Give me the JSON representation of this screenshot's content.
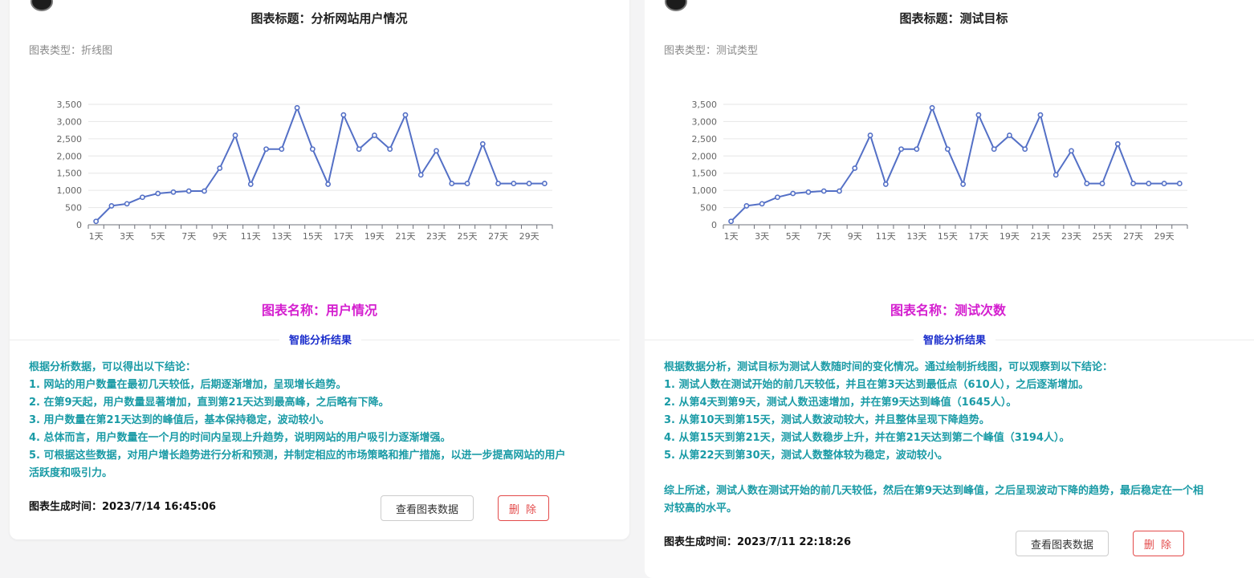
{
  "cards": [
    {
      "chart_title": "图表标题：分析网站用户情况",
      "chart_type_prefix": "图表类型：",
      "chart_type": "折线图",
      "chart_name": "图表名称：用户情况",
      "analysis_heading": "智能分析结果",
      "analysis_lines": [
        "根据分析数据，可以得出以下结论：",
        "1. 网站的用户数量在最初几天较低，后期逐渐增加，呈现增长趋势。",
        "2. 在第9天起，用户数量显著增加，直到第21天达到最高峰，之后略有下降。",
        "3. 用户数量在第21天达到的峰值后，基本保持稳定，波动较小。",
        "4. 总体而言，用户数量在一个月的时间内呈现上升趋势，说明网站的用户吸引力逐渐增强。",
        "5. 可根据这些数据，对用户增长趋势进行分析和预测，并制定相应的市场策略和推广措施，以进一步提高网站的用户",
        "活跃度和吸引力。"
      ],
      "generated_time": "图表生成时间：2023/7/14 16:45:06",
      "view_button": "查看图表数据",
      "delete_button": "删 除"
    },
    {
      "chart_title": "图表标题：测试目标",
      "chart_type_prefix": "图表类型：",
      "chart_type": "测试类型",
      "chart_name": "图表名称：测试次数",
      "analysis_heading": "智能分析结果",
      "analysis_lines": [
        "根据数据分析，测试目标为测试人数随时间的变化情况。通过绘制折线图，可以观察到以下结论：",
        "1. 测试人数在测试开始的前几天较低，并且在第3天达到最低点（610人），之后逐渐增加。",
        "2. 从第4天到第9天，测试人数迅速增加，并在第9天达到峰值（1645人）。",
        "3. 从第10天到第15天，测试人数波动较大，并且整体呈现下降趋势。",
        "4. 从第15天到第21天，测试人数稳步上升，并在第21天达到第二个峰值（3194人）。",
        "5. 从第22天到第30天，测试人数整体较为稳定，波动较小。",
        "",
        "综上所述，测试人数在测试开始的前几天较低，然后在第9天达到峰值，之后呈现波动下降的趋势，最后稳定在一个相",
        "对较高的水平。"
      ],
      "generated_time": "图表生成时间：2023/7/11 22:18:26",
      "view_button": "查看图表数据",
      "delete_button": "删 除"
    }
  ],
  "chart_data": [
    {
      "type": "line",
      "categories": [
        "1天",
        "2天",
        "3天",
        "4天",
        "5天",
        "6天",
        "7天",
        "8天",
        "9天",
        "10天",
        "11天",
        "12天",
        "13天",
        "14天",
        "15天",
        "16天",
        "17天",
        "18天",
        "19天",
        "20天",
        "21天",
        "22天",
        "23天",
        "24天",
        "25天",
        "26天",
        "27天",
        "28天",
        "29天",
        "30天"
      ],
      "tick_labels": [
        "1天",
        "3天",
        "5天",
        "7天",
        "9天",
        "11天",
        "13天",
        "15天",
        "17天",
        "19天",
        "21天",
        "23天",
        "25天",
        "27天",
        "29天"
      ],
      "values": [
        100,
        550,
        610,
        800,
        910,
        950,
        980,
        980,
        1645,
        2600,
        1180,
        2200,
        2200,
        3400,
        2200,
        1180,
        3194,
        2200,
        2600,
        2200,
        3194,
        1450,
        2150,
        1200,
        1200,
        2350,
        1200,
        1200,
        1200,
        1200
      ],
      "ylim": [
        0,
        3500
      ],
      "yticks": [
        0,
        500,
        1000,
        1500,
        2000,
        2500,
        3000,
        3500
      ],
      "ytick_labels": [
        "0",
        "500",
        "1,000",
        "1,500",
        "2,000",
        "2,500",
        "3,000",
        "3,500"
      ],
      "grid": true,
      "line_color": "#5470c6"
    },
    {
      "type": "line",
      "categories": [
        "1天",
        "2天",
        "3天",
        "4天",
        "5天",
        "6天",
        "7天",
        "8天",
        "9天",
        "10天",
        "11天",
        "12天",
        "13天",
        "14天",
        "15天",
        "16天",
        "17天",
        "18天",
        "19天",
        "20天",
        "21天",
        "22天",
        "23天",
        "24天",
        "25天",
        "26天",
        "27天",
        "28天",
        "29天",
        "30天"
      ],
      "tick_labels": [
        "1天",
        "3天",
        "5天",
        "7天",
        "9天",
        "11天",
        "13天",
        "15天",
        "17天",
        "19天",
        "21天",
        "23天",
        "25天",
        "27天",
        "29天"
      ],
      "values": [
        100,
        550,
        610,
        800,
        910,
        950,
        980,
        980,
        1645,
        2600,
        1180,
        2200,
        2200,
        3400,
        2200,
        1180,
        3194,
        2200,
        2600,
        2200,
        3194,
        1450,
        2150,
        1200,
        1200,
        2350,
        1200,
        1200,
        1200,
        1200
      ],
      "ylim": [
        0,
        3500
      ],
      "yticks": [
        0,
        500,
        1000,
        1500,
        2000,
        2500,
        3000,
        3500
      ],
      "ytick_labels": [
        "0",
        "500",
        "1,000",
        "1,500",
        "2,000",
        "2,500",
        "3,000",
        "3,500"
      ],
      "grid": true,
      "line_color": "#5470c6"
    }
  ]
}
